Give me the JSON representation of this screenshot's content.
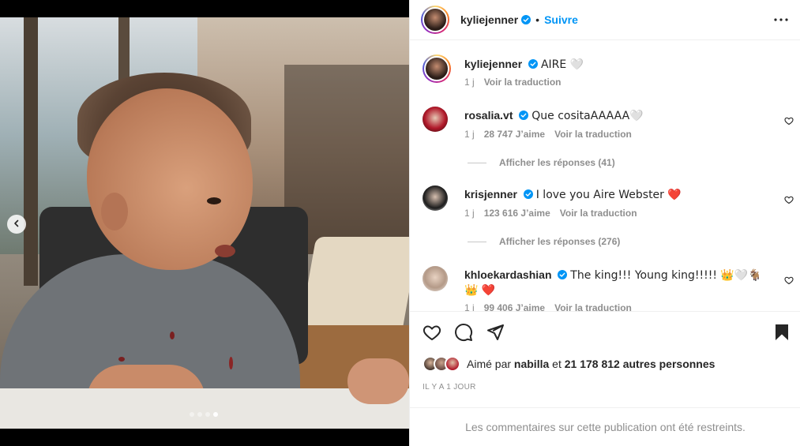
{
  "post": {
    "author": "kyliejenner",
    "follow_label": "Suivre",
    "bullet": "•",
    "more_icon": "more-options-icon",
    "carousel": {
      "total": 4,
      "active_index": 3
    }
  },
  "caption": {
    "username": "kyliejenner",
    "text": "AIRE 🤍",
    "time": "1 j",
    "translate_label": "Voir la traduction"
  },
  "comments": [
    {
      "username": "rosalia.vt",
      "text": "Que cositaAAAAA🤍",
      "time": "1 j",
      "likes": "28 747 J’aime",
      "translate_label": "Voir la traduction",
      "replies_label": "Afficher les réponses (41)"
    },
    {
      "username": "krisjenner",
      "text": "I love you Aire Webster ❤️",
      "time": "1 j",
      "likes": "123 616 J’aime",
      "translate_label": "Voir la traduction",
      "replies_label": "Afficher les réponses (276)"
    },
    {
      "username": "khloekardashian",
      "text": "The king!!! Young king!!!!! 👑🤍🐐👑 ❤️",
      "time": "1 j",
      "likes": "99 406 J’aime",
      "translate_label": "Voir la traduction"
    }
  ],
  "likes": {
    "prefix": "Aimé par",
    "liker": "nabilla",
    "connector": "et",
    "others": "21 178 812 autres personnes"
  },
  "timestamp": "IL Y A 1 JOUR",
  "restricted_notice": "Les commentaires sur cette publication ont été restreints.",
  "colors": {
    "accent": "#0095f6",
    "text": "#262626",
    "muted": "#8e8e8e",
    "divider": "#efefef"
  }
}
